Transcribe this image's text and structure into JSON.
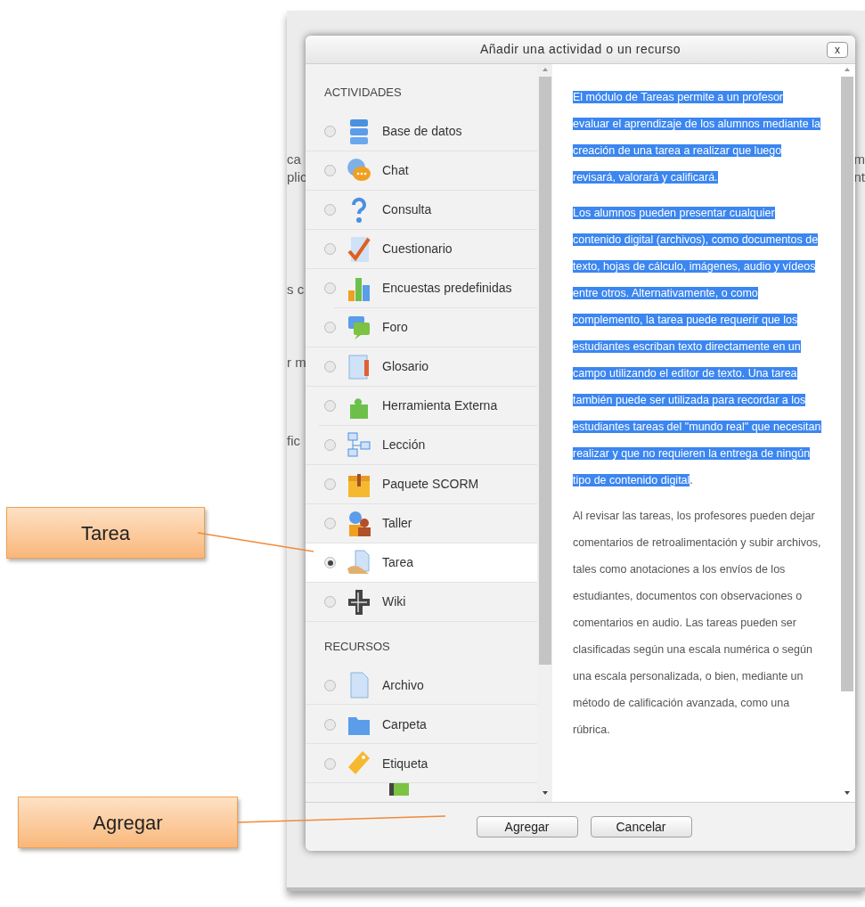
{
  "background": {
    "fragments": [
      "ca",
      "plic",
      "s c",
      "r m",
      "fic",
      "m",
      "nt"
    ]
  },
  "dialog": {
    "title": "Añadir una actividad o un recurso",
    "close": "x",
    "sections": [
      {
        "heading": "ACTIVIDADES",
        "items": [
          {
            "label": "Base de datos",
            "selected": false
          },
          {
            "label": "Chat",
            "selected": false
          },
          {
            "label": "Consulta",
            "selected": false
          },
          {
            "label": "Cuestionario",
            "selected": false
          },
          {
            "label": "Encuestas predefinidas",
            "selected": false
          },
          {
            "label": "Foro",
            "selected": false
          },
          {
            "label": "Glosario",
            "selected": false
          },
          {
            "label": "Herramienta Externa",
            "selected": false
          },
          {
            "label": "Lección",
            "selected": false
          },
          {
            "label": "Paquete SCORM",
            "selected": false
          },
          {
            "label": "Taller",
            "selected": false
          },
          {
            "label": "Tarea",
            "selected": true
          },
          {
            "label": "Wiki",
            "selected": false
          }
        ]
      },
      {
        "heading": "RECURSOS",
        "items": [
          {
            "label": "Archivo",
            "selected": false
          },
          {
            "label": "Carpeta",
            "selected": false
          },
          {
            "label": "Etiqueta",
            "selected": false
          }
        ]
      }
    ],
    "description": [
      {
        "segments": [
          {
            "text": "El módulo de Tareas permite a un profesor evaluar el aprendizaje de los alumnos mediante la creación de una tarea a realizar que luego revisará, valorará y calificará.",
            "highlighted": true
          }
        ]
      },
      {
        "segments": [
          {
            "text": "Los alumnos pueden presentar cualquier contenido digital (archivos), como documentos de texto, hojas de cálculo, imágenes, audio y vídeos entre otros. Alternativamente, o como complemento, la tarea puede requerir que los estudiantes escriban texto directamente en un campo utilizando el editor de texto. Una tarea también puede ser utilizada para recordar a los estudiantes tareas del \"mundo real\" que necesitan realizar y que no requieren la entrega de ningún tipo de contenido digital",
            "highlighted": true
          },
          {
            "text": ".",
            "highlighted": false
          }
        ]
      },
      {
        "segments": [
          {
            "text": "Al revisar las tareas, los profesores pueden dejar comentarios de retroalimentación y subir archivos, tales como anotaciones a los envíos de los estudiantes, documentos con observaciones o comentarios en audio. Las tareas pueden ser clasificadas según una escala numérica o según una escala personalizada, o bien, mediante un método de calificación avanzada, como una rúbrica.",
            "highlighted": false
          }
        ]
      }
    ],
    "buttons": [
      "Agregar",
      "Cancelar"
    ]
  },
  "callouts": [
    {
      "label": "Tarea"
    },
    {
      "label": "Agregar"
    }
  ]
}
